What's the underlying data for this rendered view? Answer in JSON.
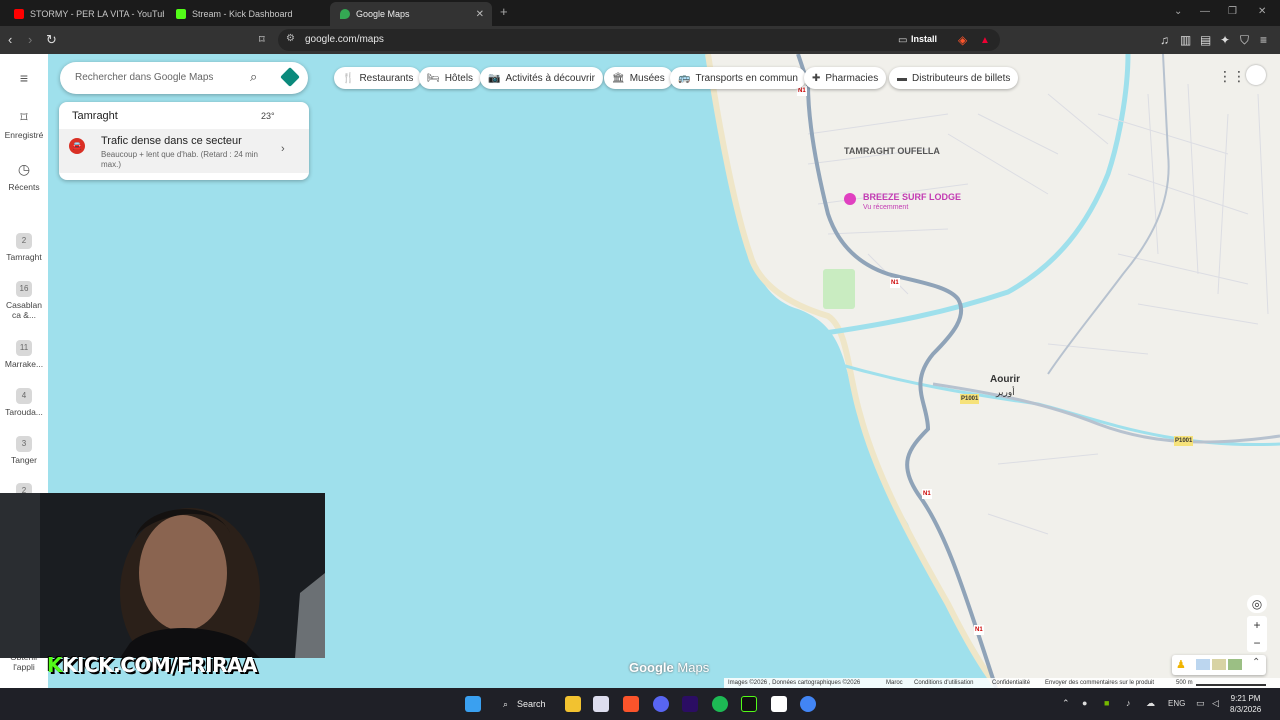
{
  "tabs": [
    {
      "title": "STORMY - PER LA VITA - YouTube",
      "icon": "youtube-icon",
      "color": "#ff0000"
    },
    {
      "title": "Stream - Kick Dashboard",
      "icon": "kick-icon",
      "color": "#53fc18"
    },
    {
      "title": "Google Maps",
      "icon": "google-maps-icon",
      "color": "#34a853"
    }
  ],
  "address": {
    "url": "google.com/maps",
    "install_label": "Install"
  },
  "rail": {
    "saved_label": "Enregistré",
    "recents_label": "Récents",
    "recent_places": [
      {
        "count": "2",
        "name": "Tamraght"
      },
      {
        "count": "16",
        "name": "Casablan ca &..."
      },
      {
        "count": "11",
        "name": "Marrake..."
      },
      {
        "count": "4",
        "name": "Tarouda..."
      },
      {
        "count": "3",
        "name": "Tanger"
      },
      {
        "count": "2",
        "name": ""
      }
    ],
    "get_app_label": "Obtenir l'appli"
  },
  "search": {
    "placeholder": "Rechercher dans Google Maps"
  },
  "categories": [
    {
      "label": "Restaurants",
      "icon": "fork-knife-icon"
    },
    {
      "label": "Hôtels",
      "icon": "bed-icon"
    },
    {
      "label": "Activités à découvrir",
      "icon": "camera-icon"
    },
    {
      "label": "Musées",
      "icon": "museum-icon"
    },
    {
      "label": "Transports en commun",
      "icon": "bus-icon"
    },
    {
      "label": "Pharmacies",
      "icon": "pharmacy-icon"
    },
    {
      "label": "Distributeurs de billets",
      "icon": "atm-icon"
    }
  ],
  "card": {
    "location": "Tamraght",
    "temperature": "23°",
    "traffic_title": "Trafic dense dans ce secteur",
    "traffic_detail": "Beaucoup + lent que d'hab. (Retard : 24 min max.)"
  },
  "map": {
    "places": [
      {
        "name": "TAMRAGHT OUFELLA"
      },
      {
        "name": "BREEZE SURF LODGE",
        "sub": "Vu récemment"
      },
      {
        "name": "Aourir",
        "alt": "أورير"
      }
    ],
    "road_labels": [
      "N1",
      "N1",
      "N1",
      "N1",
      "P1001",
      "P1001"
    ],
    "logo": {
      "brand": "Google",
      "product": "Maps"
    },
    "footer": {
      "imagery": "Images ©2026 , Données cartographiques ©2026",
      "country": "Maroc",
      "terms": "Conditions d'utilisation",
      "privacy": "Confidentialité",
      "feedback": "Envoyer des commentaires sur le produit",
      "scale": "500 m"
    }
  },
  "stream": {
    "overlay_prefix": "K",
    "overlay_text": "KICK.COM/FRIRAA"
  },
  "taskbar": {
    "search_label": "Search",
    "lang": "ENG",
    "time": "9:21 PM",
    "date": "8/3/2026"
  }
}
